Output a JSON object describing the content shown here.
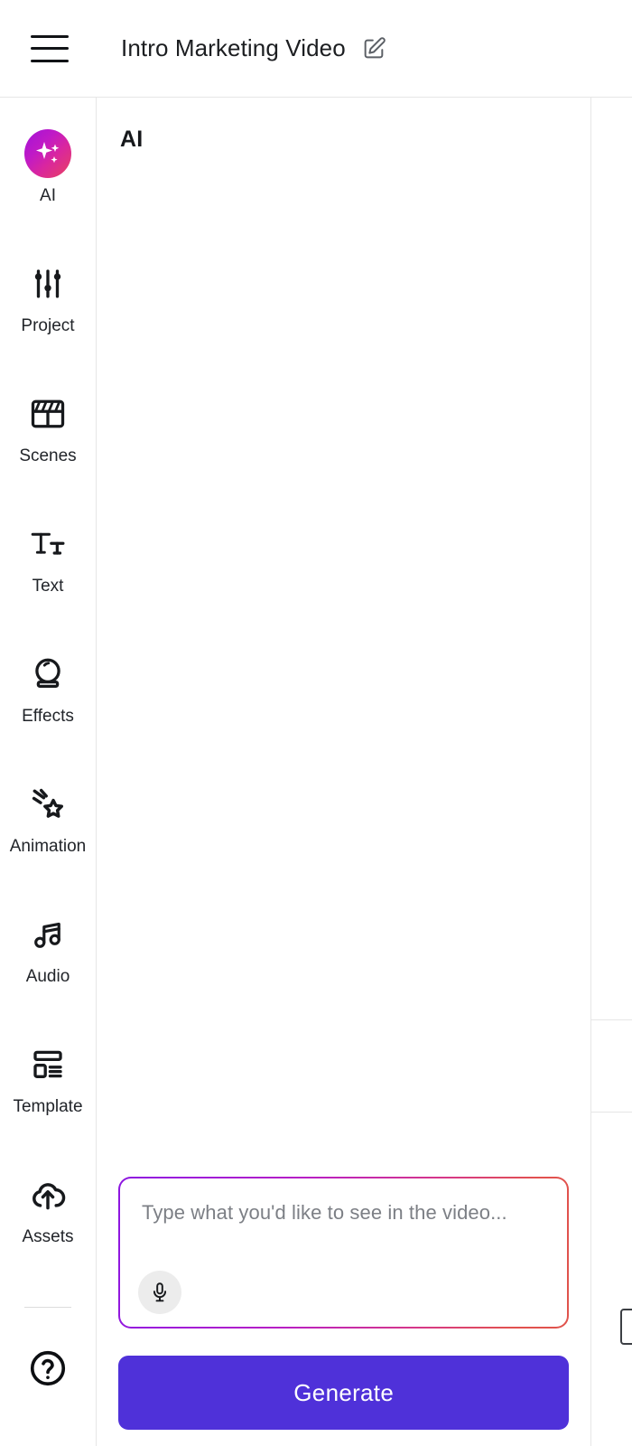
{
  "topbar": {
    "menu_icon": "hamburger-menu-icon",
    "title": "Intro Marketing Video",
    "edit_icon": "edit-pencil-square-icon"
  },
  "sidebar": {
    "items": [
      {
        "label": "AI",
        "icon": "ai-sparkles-icon"
      },
      {
        "label": "Project",
        "icon": "sliders-settings-icon"
      },
      {
        "label": "Scenes",
        "icon": "clapperboard-icon"
      },
      {
        "label": "Text",
        "icon": "text-tt-icon"
      },
      {
        "label": "Effects",
        "icon": "crystal-ball-icon"
      },
      {
        "label": "Animation",
        "icon": "shooting-star-icon"
      },
      {
        "label": "Audio",
        "icon": "music-note-icon"
      },
      {
        "label": "Template",
        "icon": "layout-template-icon"
      },
      {
        "label": "Assets",
        "icon": "cloud-upload-icon"
      }
    ],
    "help_icon": "question-circle-icon"
  },
  "panel": {
    "title": "AI",
    "prompt": {
      "value": "",
      "placeholder": "Type what you'd like to see in the video...",
      "mic_icon": "microphone-icon"
    },
    "generate_label": "Generate"
  },
  "colors": {
    "accent_purple": "#4f31d9",
    "gradient_start": "#8c16e0",
    "gradient_end": "#e0534c",
    "border": "#e6e6e6",
    "text_primary": "#16181b",
    "text_placeholder": "#7c7f85"
  }
}
